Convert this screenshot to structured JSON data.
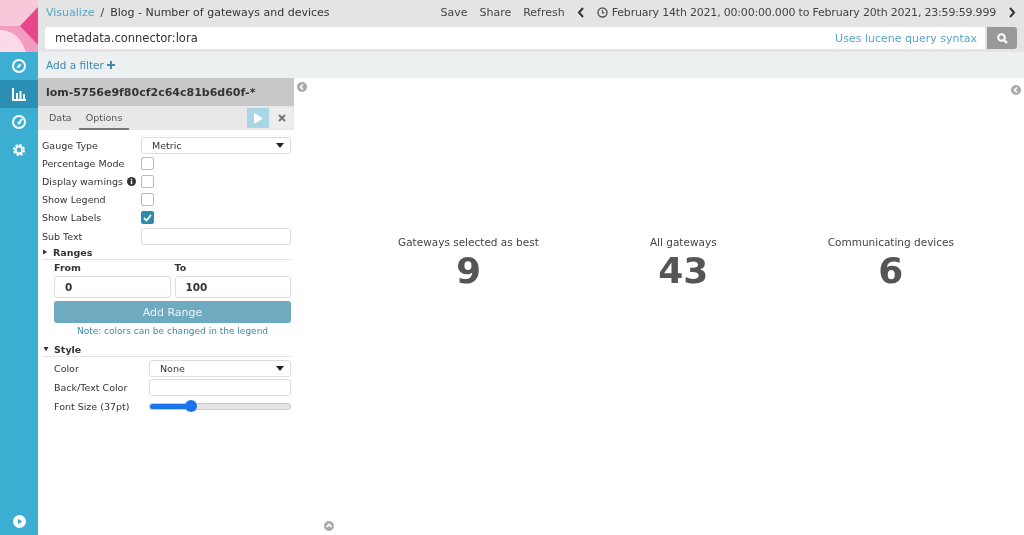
{
  "breadcrumb": {
    "link": "Visualize",
    "separator": "/",
    "title": "Blog - Number of gateways and devices"
  },
  "top_actions": [
    "Save",
    "Share",
    "Refresh"
  ],
  "time_range": "February 14th 2021, 00:00:00.000 to February 20th 2021, 23:59:59.999",
  "query": {
    "value": "metadata.connector:lora",
    "hint": "Uses lucene query syntax"
  },
  "add_filter": "Add a filter",
  "nav": [
    {
      "kind": "compass",
      "selected": false
    },
    {
      "kind": "chart",
      "selected": true
    },
    {
      "kind": "gauge",
      "selected": false
    },
    {
      "kind": "gear",
      "selected": false
    }
  ],
  "panel": {
    "title": "lom-5756e9f80cf2c64c81b6d60f-*",
    "tabs": [
      {
        "label": "Data",
        "selected": false
      },
      {
        "label": "Options",
        "selected": true
      }
    ],
    "options": [
      {
        "kind": "select",
        "label": "Gauge Type",
        "value": "Metric"
      },
      {
        "kind": "checkbox",
        "label": "Percentage Mode",
        "checked": false
      },
      {
        "kind": "checkbox",
        "label": "Display warnings",
        "checked": false,
        "info": true
      },
      {
        "kind": "checkbox",
        "label": "Show Legend",
        "checked": false
      },
      {
        "kind": "checkbox",
        "label": "Show Labels",
        "checked": true
      },
      {
        "kind": "text",
        "label": "Sub Text"
      }
    ],
    "ranges": {
      "title": "Ranges",
      "expanded": false,
      "from_label": "From",
      "to_label": "To",
      "from": "0",
      "to": "100",
      "button": "Add Range",
      "note": "Note: colors can be changed in the legend"
    },
    "style": {
      "title": "Style",
      "expanded": true,
      "fields": [
        {
          "kind": "select",
          "label": "Color",
          "value": "None"
        },
        {
          "kind": "text",
          "label": "Back/Text Color"
        },
        {
          "kind": "slider",
          "label": "Font Size (37pt)",
          "level": 0.29
        }
      ]
    }
  },
  "metrics": [
    {
      "label": "Gateways selected as best",
      "value": "9"
    },
    {
      "label": "All gateways",
      "value": "43"
    },
    {
      "label": "Communicating devices",
      "value": "6"
    }
  ]
}
